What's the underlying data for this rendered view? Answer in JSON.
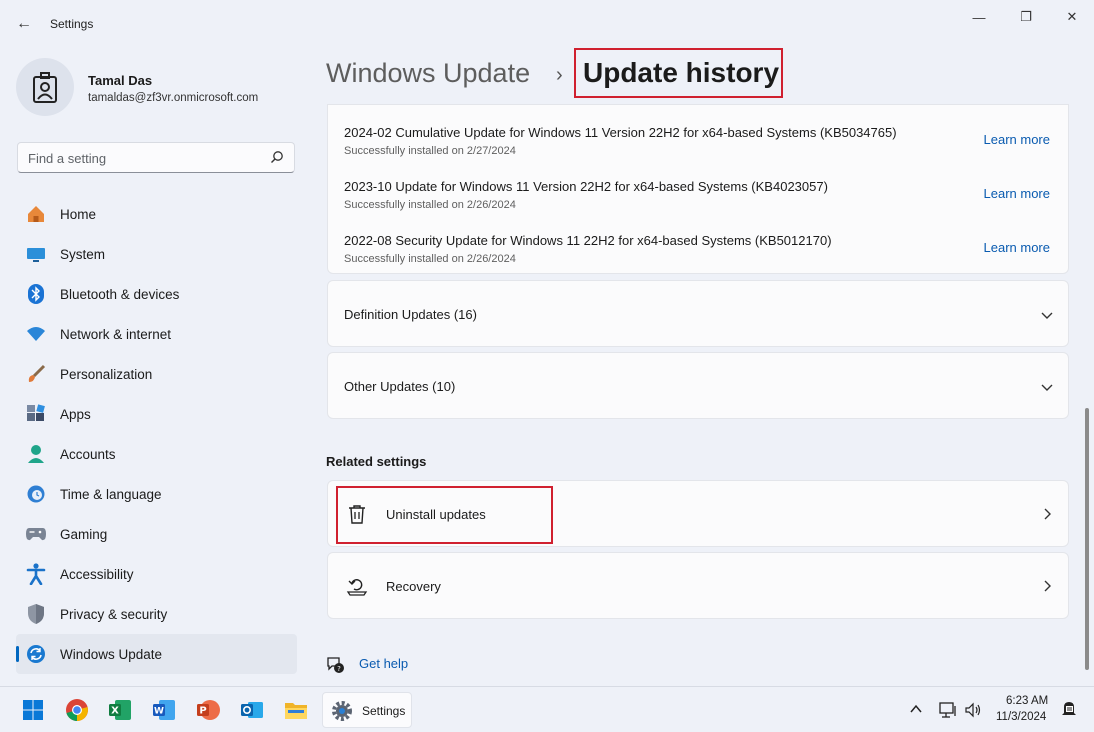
{
  "window": {
    "title": "Settings",
    "back_glyph": "←",
    "minimize_glyph": "—",
    "maximize_glyph": "❐",
    "close_glyph": "✕"
  },
  "profile": {
    "name": "Tamal Das",
    "email": "tamaldas@zf3vr.onmicrosoft.com",
    "avatar_icon": "id-badge-icon"
  },
  "search": {
    "placeholder": "Find a setting",
    "icon": "search-icon"
  },
  "nav": {
    "items": [
      {
        "label": "Home",
        "icon": "home-icon"
      },
      {
        "label": "System",
        "icon": "monitor-icon"
      },
      {
        "label": "Bluetooth & devices",
        "icon": "bluetooth-icon"
      },
      {
        "label": "Network & internet",
        "icon": "wifi-icon"
      },
      {
        "label": "Personalization",
        "icon": "brush-icon"
      },
      {
        "label": "Apps",
        "icon": "apps-icon"
      },
      {
        "label": "Accounts",
        "icon": "accounts-icon"
      },
      {
        "label": "Time & language",
        "icon": "clock-globe-icon"
      },
      {
        "label": "Gaming",
        "icon": "gamepad-icon"
      },
      {
        "label": "Accessibility",
        "icon": "accessibility-icon"
      },
      {
        "label": "Privacy & security",
        "icon": "shield-icon"
      },
      {
        "label": "Windows Update",
        "icon": "windows-update-icon",
        "active": true
      }
    ]
  },
  "breadcrumb": {
    "parent": "Windows Update",
    "separator": "›",
    "current": "Update history"
  },
  "quality_updates": [
    {
      "title": "2024-02 Cumulative Update for Windows 11 Version 22H2 for x64-based Systems (KB5034765)",
      "status": "Successfully installed on 2/27/2024",
      "link": "Learn more"
    },
    {
      "title": "2023-10 Update for Windows 11 Version 22H2 for x64-based Systems (KB4023057)",
      "status": "Successfully installed on 2/26/2024",
      "link": "Learn more"
    },
    {
      "title": "2022-08 Security Update for Windows 11 22H2 for x64-based Systems (KB5012170)",
      "status": "Successfully installed on 2/26/2024",
      "link": "Learn more"
    }
  ],
  "expanders": {
    "definition": "Definition Updates (16)",
    "other": "Other Updates (10)"
  },
  "related": {
    "title": "Related settings",
    "uninstall": "Uninstall updates",
    "recovery": "Recovery"
  },
  "get_help": "Get help",
  "taskbar": {
    "apps": [
      "start-icon",
      "chrome-icon",
      "excel-icon",
      "word-icon",
      "powerpoint-icon",
      "outlook-icon",
      "file-explorer-icon"
    ],
    "settings_label": "Settings",
    "time": "6:23 AM",
    "date": "11/3/2024"
  },
  "colors": {
    "accent": "#0067c0",
    "highlight": "#d0202f",
    "link": "#0a5bb0"
  }
}
